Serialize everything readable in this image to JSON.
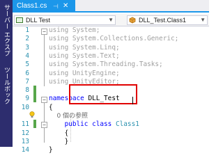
{
  "side_panel": {
    "tabs": [
      "サーバー エクスプローラー",
      "ツールボックス"
    ]
  },
  "tabs": {
    "active_file": "Class1.cs",
    "pin_icon": "pin-icon",
    "close_icon": "close-icon"
  },
  "navbar": {
    "project": "DLL Test",
    "class_scope": "DLL_Test.Class1"
  },
  "code": {
    "lines": [
      {
        "num": "1",
        "parts": [
          {
            "t": "using",
            "c": "gray"
          },
          {
            "t": " System;",
            "c": "gray"
          }
        ]
      },
      {
        "num": "2",
        "parts": [
          {
            "t": "using",
            "c": "gray"
          },
          {
            "t": " System.Collections.Generic;",
            "c": "gray"
          }
        ]
      },
      {
        "num": "3",
        "parts": [
          {
            "t": "using",
            "c": "gray"
          },
          {
            "t": " System.Linq;",
            "c": "gray"
          }
        ]
      },
      {
        "num": "4",
        "parts": [
          {
            "t": "using",
            "c": "gray"
          },
          {
            "t": " System.Text;",
            "c": "gray"
          }
        ]
      },
      {
        "num": "5",
        "parts": [
          {
            "t": "using",
            "c": "gray"
          },
          {
            "t": " System.Threading.Tasks;",
            "c": "gray"
          }
        ]
      },
      {
        "num": "6",
        "parts": [
          {
            "t": "using",
            "c": "gray"
          },
          {
            "t": " UnityEngine;",
            "c": "gray"
          }
        ]
      },
      {
        "num": "7",
        "parts": [
          {
            "t": "using",
            "c": "gray"
          },
          {
            "t": " UnityEditor;",
            "c": "gray"
          }
        ]
      },
      {
        "num": "8",
        "parts": []
      },
      {
        "num": "9",
        "parts": [
          {
            "t": "namespace",
            "c": "kw"
          },
          {
            "t": " DLL_Test",
            "c": ""
          }
        ]
      },
      {
        "num": "10",
        "parts": [
          {
            "t": "{",
            "c": ""
          }
        ]
      },
      {
        "num": "",
        "parts": [
          {
            "t": "    0 個の参照",
            "c": "cm"
          }
        ]
      },
      {
        "num": "11",
        "parts": [
          {
            "t": "    public",
            "c": "kw"
          },
          {
            "t": " ",
            "c": ""
          },
          {
            "t": "class",
            "c": "kw"
          },
          {
            "t": " ",
            "c": ""
          },
          {
            "t": "Class1",
            "c": "cls"
          }
        ]
      },
      {
        "num": "12",
        "parts": [
          {
            "t": "    {",
            "c": ""
          }
        ]
      },
      {
        "num": "13",
        "parts": [
          {
            "t": "    }",
            "c": ""
          }
        ]
      },
      {
        "num": "14",
        "parts": [
          {
            "t": "}",
            "c": ""
          }
        ]
      }
    ]
  }
}
